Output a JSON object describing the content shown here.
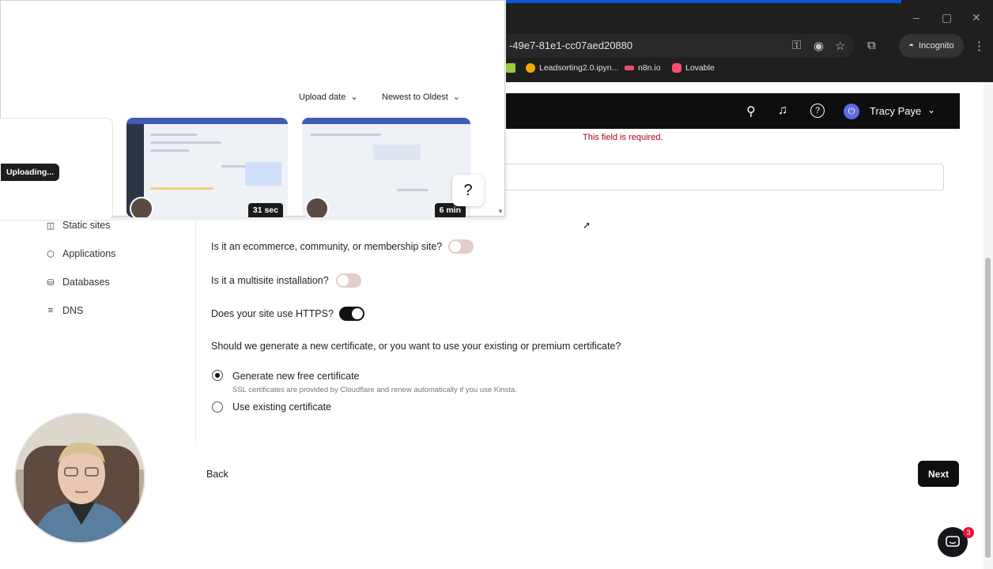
{
  "browser": {
    "url": "-49e7-81e1-cc07aed20880",
    "incognito_label": "Incognito",
    "bookmarks": [
      {
        "label": "Leadsorting2.0.ipyn...",
        "color": "#f2a900"
      },
      {
        "label": "n8n.io",
        "color": "#ea4b71"
      },
      {
        "label": "Lovable",
        "color": "#ff4d6d"
      }
    ],
    "window_controls": {
      "minimize": "–",
      "maximize": "▢",
      "close": "✕"
    }
  },
  "header": {
    "user_name": "Tracy Paye",
    "user_initial": "⏻",
    "icons": {
      "search": "⌕",
      "bell": "🔔",
      "help": "?"
    },
    "chevron": "⌄"
  },
  "form": {
    "required_message": "This field is required.",
    "questions": [
      {
        "label": "Is it an ecommerce, community, or membership site?",
        "state": "off"
      },
      {
        "label": "Is it a multisite installation?",
        "state": "off"
      },
      {
        "label": "Does your site use HTTPS?",
        "state": "on"
      }
    ],
    "certificate_question": "Should we generate a new certificate, or you want to use your existing or premium certificate?",
    "options": [
      {
        "label": "Generate new free certificate",
        "selected": true,
        "hint": "SSL certificates are provided by Cloudflare and renew automatically if you use Kinsta."
      },
      {
        "label": "Use existing certificate",
        "selected": false
      }
    ],
    "back_label": "Back",
    "next_label": "Next"
  },
  "sidebar": {
    "items": [
      {
        "label": "Static sites",
        "icon": "static-sites-icon",
        "glyph": "◫"
      },
      {
        "label": "Applications",
        "icon": "layers-icon",
        "glyph": "⬡"
      },
      {
        "label": "Databases",
        "icon": "database-icon",
        "glyph": "⛁"
      },
      {
        "label": "DNS",
        "icon": "dns-icon",
        "glyph": "≡"
      }
    ]
  },
  "upload_panel": {
    "sort_by": "Upload date",
    "order": "Newest to Oldest",
    "uploading_label": "Uploading...",
    "videos": [
      {
        "duration": "31 sec"
      },
      {
        "duration": "6 min"
      }
    ],
    "help_label": "?"
  },
  "chat": {
    "badge_count": "3"
  },
  "colors": {
    "accent": "#0e0e10",
    "error": "#b00020",
    "toggle_off": "#e3cccc"
  }
}
